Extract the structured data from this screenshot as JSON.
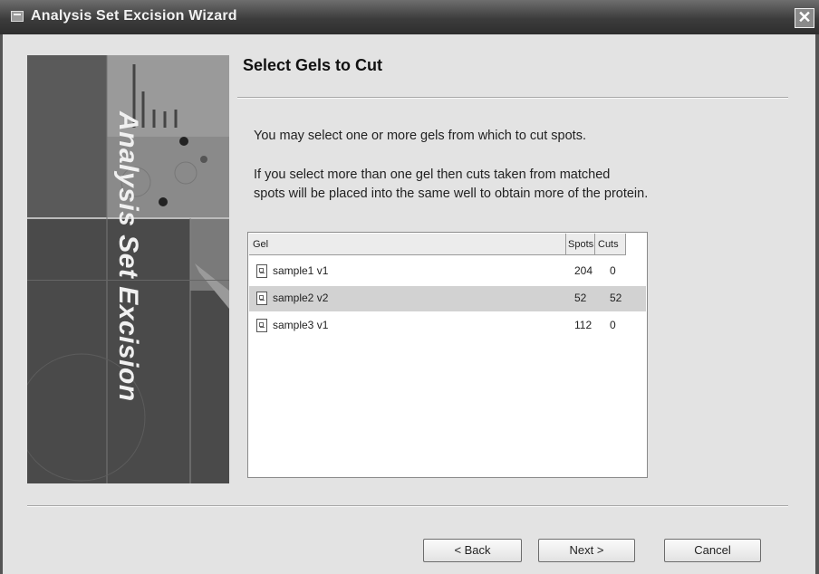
{
  "window": {
    "title": "Analysis Set Excision Wizard",
    "close_glyph": "✕"
  },
  "banner": {
    "text": "Analysis Set Excision"
  },
  "page": {
    "heading": "Select Gels to Cut",
    "intro": "You may select one or more gels from which to cut spots.",
    "detail_line1": "If you select more than one gel then cuts taken from matched",
    "detail_line2": "spots will be placed into the same well to obtain more of the protein."
  },
  "table": {
    "columns": [
      "Gel",
      "Spots",
      "Cuts"
    ],
    "rows": [
      {
        "gel": "sample1 v1",
        "spots": "204",
        "cuts": "0",
        "selected": false,
        "icon": "gel-image-icon"
      },
      {
        "gel": "sample2 v2",
        "spots": "52",
        "cuts": "52",
        "selected": true,
        "icon": "gel-image-icon"
      },
      {
        "gel": "sample3 v1",
        "spots": "112",
        "cuts": "0",
        "selected": false,
        "icon": "gel-image-icon"
      }
    ]
  },
  "buttons": {
    "back": "< Back",
    "next": "Next >",
    "cancel": "Cancel"
  },
  "colors": {
    "title_bar": "#3c3c3c",
    "banner": "#505050",
    "selected_row": "#d2d2d2"
  }
}
